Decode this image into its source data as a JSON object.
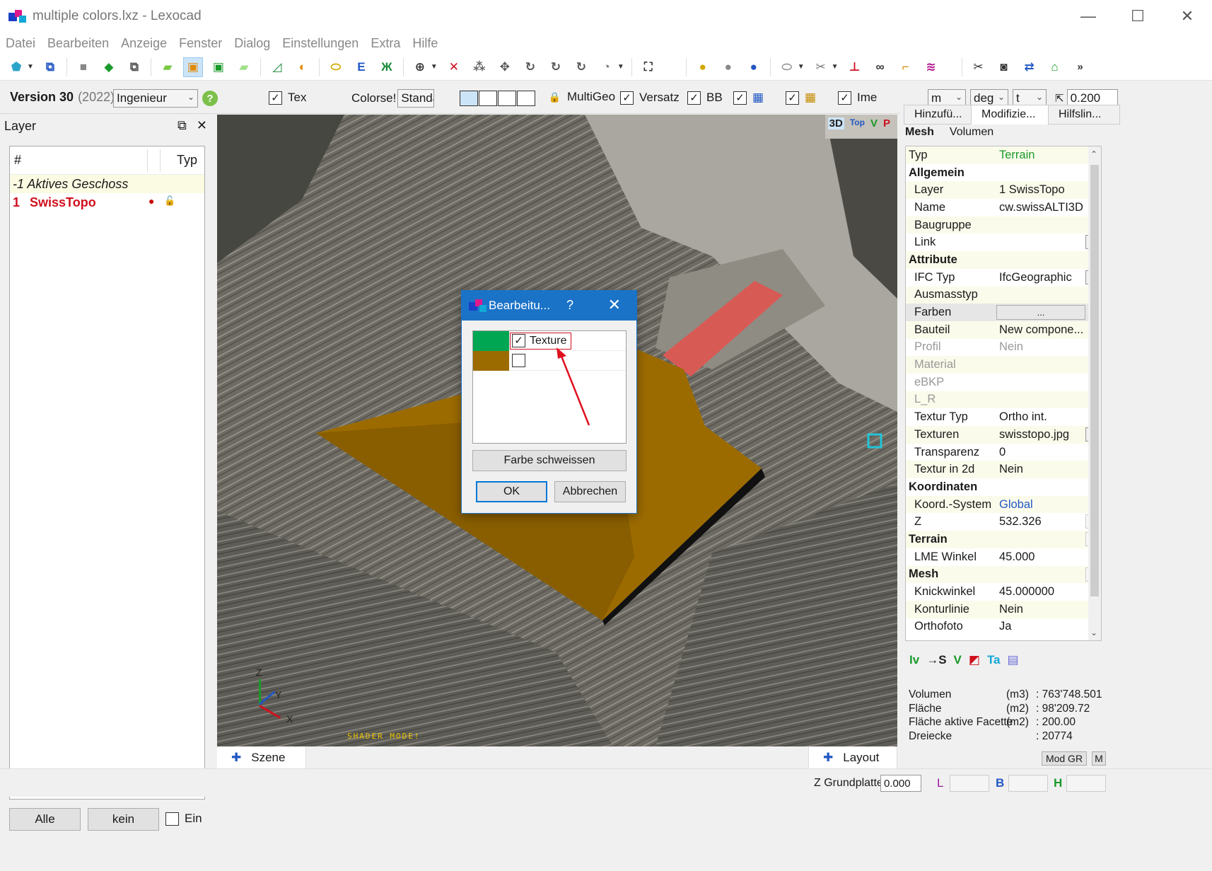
{
  "window": {
    "title": "multiple colors.lxz - Lexocad",
    "minimize": "—",
    "maximize": "☐",
    "close": "✕"
  },
  "menu": [
    "Datei",
    "Bearbeiten",
    "Anzeige",
    "Fenster",
    "Dialog",
    "Einstellungen",
    "Extra",
    "Hilfe"
  ],
  "options": {
    "version_label": "Version 30",
    "version_year": "(2022)",
    "profile": "Ingenieur",
    "tex_label": "Tex",
    "colorset_label": "Colorse!",
    "colorset_value": "Standaı",
    "multigeo_label": "MultiGeo",
    "versatz_label": "Versatz",
    "bb_label": "BB",
    "ime_label": "Ime",
    "unit_length": "m",
    "unit_angle": "deg",
    "unit_t": "t",
    "snap_value": "0.200"
  },
  "layer_panel": {
    "title": "Layer",
    "col_hash": "#",
    "col_typ": "Typ",
    "active_floor": "-1 Aktives Geschoss",
    "layer_num": "1",
    "layer_name": "SwissTopo",
    "btn_all": "Alle",
    "btn_none": "kein",
    "ein_label": "Ein"
  },
  "viewport": {
    "view_modes": [
      "3D",
      "Top",
      "V",
      "P"
    ],
    "shader_text": "SHADER MODE!",
    "axis_z": "Z",
    "axis_y": "Y",
    "axis_x": "X",
    "tab_scene": "Szene",
    "tab_layout": "Layout"
  },
  "dialog": {
    "title": "Bearbeitu...",
    "help": "?",
    "close": "✕",
    "rows": [
      {
        "color": "#00a652",
        "checked": true,
        "label": "Texture"
      },
      {
        "color": "#9c6b00",
        "checked": false,
        "label": ""
      }
    ],
    "btn_weld": "Farbe schweissen",
    "btn_ok": "OK",
    "btn_cancel": "Abbrechen"
  },
  "right_panel": {
    "tabs": [
      "Hinzufü...",
      "Modifizie...",
      "Hilfslin..."
    ],
    "subtabs": [
      "Mesh",
      "Volumen"
    ],
    "props": [
      {
        "k": "Typ",
        "v": "Terrain",
        "type": "typ"
      },
      {
        "k": "Allgemein",
        "v": "",
        "type": "section"
      },
      {
        "k": "Layer",
        "v": "1  SwissTopo",
        "type": "normal"
      },
      {
        "k": "Name",
        "v": "cw.swissALTI3D",
        "type": "normal"
      },
      {
        "k": "Baugruppe",
        "v": "",
        "type": "normal"
      },
      {
        "k": "Link",
        "v": "",
        "type": "dots"
      },
      {
        "k": "Attribute",
        "v": "",
        "type": "section"
      },
      {
        "k": "IFC Typ",
        "v": "IfcGeographic",
        "type": "dots"
      },
      {
        "k": "Ausmasstyp",
        "v": "",
        "type": "normal"
      },
      {
        "k": "Farben",
        "v": "...",
        "type": "farben"
      },
      {
        "k": "Bauteil",
        "v": "New compone...",
        "type": "normal"
      },
      {
        "k": "Profil",
        "v": "Nein",
        "type": "grey"
      },
      {
        "k": "Material",
        "v": "",
        "type": "grey"
      },
      {
        "k": "eBKP",
        "v": "",
        "type": "grey"
      },
      {
        "k": "L_R",
        "v": "",
        "type": "grey"
      },
      {
        "k": "Textur Typ",
        "v": "Ortho int.",
        "type": "normal"
      },
      {
        "k": "Texturen",
        "v": "swisstopo.jpg",
        "type": "dots"
      },
      {
        "k": "Transparenz",
        "v": "0",
        "type": "normal"
      },
      {
        "k": "Textur in 2d",
        "v": "Nein",
        "type": "normal"
      },
      {
        "k": "Koordinaten",
        "v": "",
        "type": "section"
      },
      {
        "k": "Koord.-System",
        "v": "Global",
        "type": "link"
      },
      {
        "k": "Z",
        "v": "532.326",
        "type": "plus"
      },
      {
        "k": "Terrain",
        "v": "",
        "type": "section-ico"
      },
      {
        "k": "LME Winkel",
        "v": "45.000",
        "type": "normal"
      },
      {
        "k": "Mesh",
        "v": "",
        "type": "section-ico"
      },
      {
        "k": "Knickwinkel",
        "v": "45.000000",
        "type": "normal"
      },
      {
        "k": "Konturlinie",
        "v": "Nein",
        "type": "normal"
      },
      {
        "k": "Orthofoto",
        "v": "Ja",
        "type": "normal"
      }
    ],
    "icons": [
      "Iv",
      "→S",
      "V",
      "◩",
      "Ta",
      "▤"
    ],
    "stats": [
      {
        "k": "Volumen",
        "u": "(m3)",
        "v": ": 763'748.501"
      },
      {
        "k": "Fläche",
        "u": "(m2)",
        "v": ": 98'209.72"
      },
      {
        "k": "Fläche aktive Facette",
        "u": "(m2)",
        "v": ": 200.00"
      },
      {
        "k": "Dreiecke",
        "u": "",
        "v": ": 20774"
      }
    ],
    "btn_mod_gr": "Mod GR",
    "btn_m": "M"
  },
  "statusbar": {
    "z_label": "Z Grundplatte",
    "z_value": "0.000",
    "l_label": "L",
    "b_label": "B",
    "h_label": "H"
  },
  "colors": {
    "accent": "#1b73c8",
    "layer_red": "#d0101e",
    "terrain_green": "#00a652",
    "terrain_brown": "#9c6b00"
  }
}
